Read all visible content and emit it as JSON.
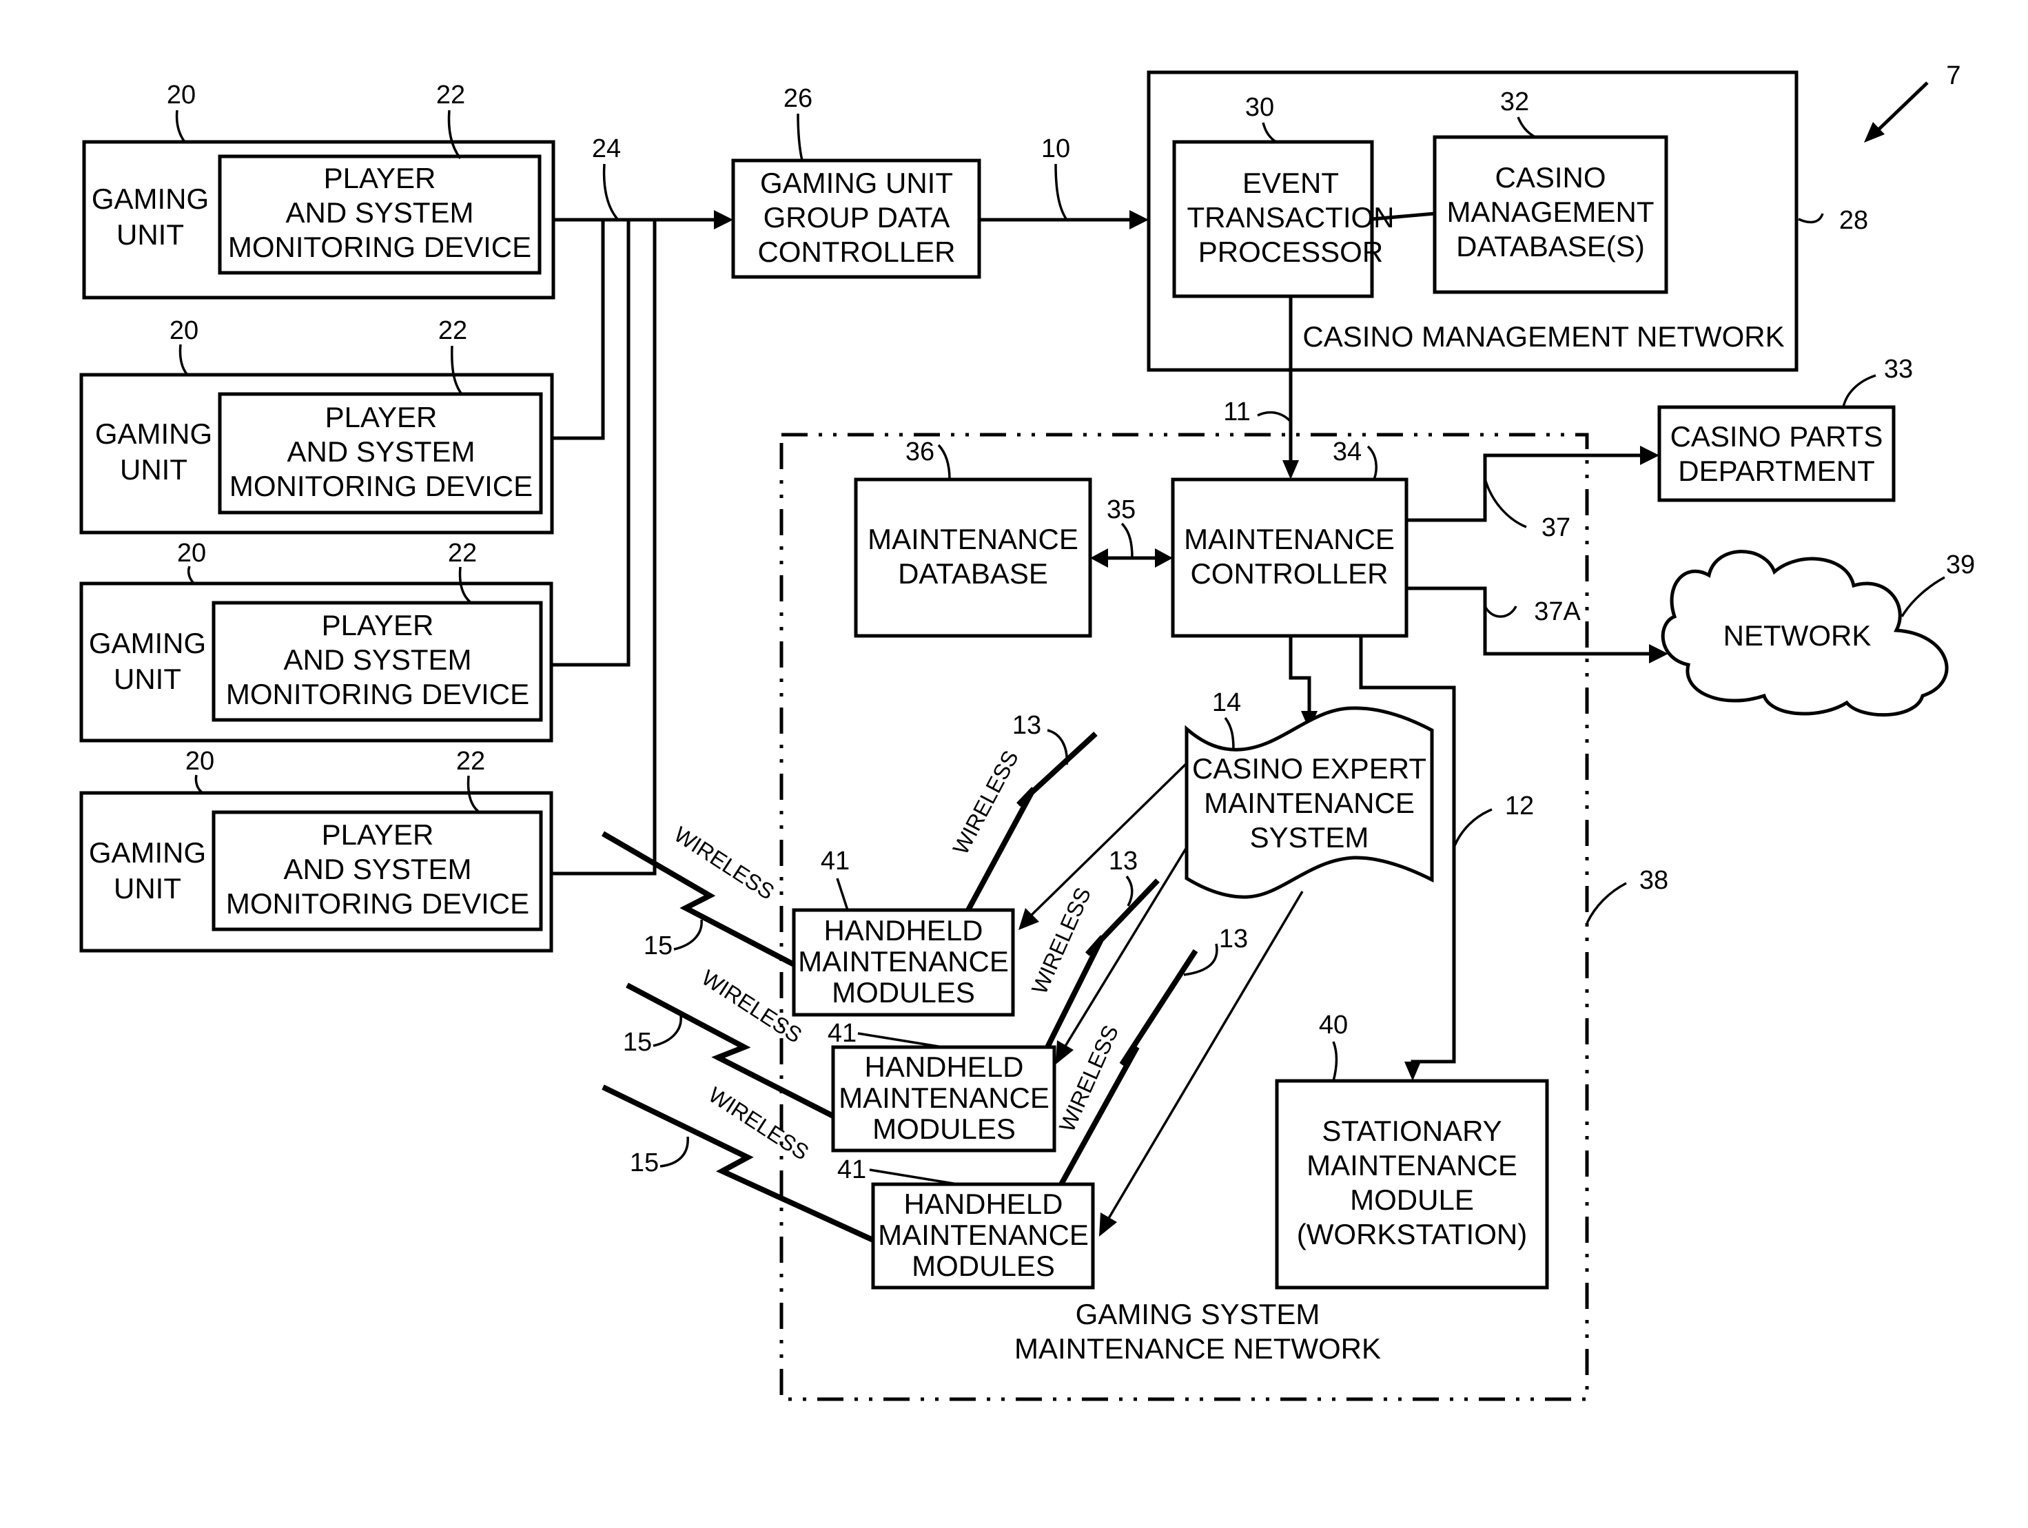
{
  "figure_ref": "7",
  "gaming_units": [
    {
      "ref": "20",
      "label": [
        "GAMING",
        "UNIT"
      ],
      "device_ref": "22",
      "device_label": [
        "PLAYER",
        "AND SYSTEM",
        "MONITORING DEVICE"
      ]
    },
    {
      "ref": "20",
      "label": [
        "GAMING",
        "UNIT"
      ],
      "device_ref": "22",
      "device_label": [
        "PLAYER",
        "AND SYSTEM",
        "MONITORING DEVICE"
      ]
    },
    {
      "ref": "20",
      "label": [
        "GAMING",
        "UNIT"
      ],
      "device_ref": "22",
      "device_label": [
        "PLAYER",
        "AND SYSTEM",
        "MONITORING DEVICE"
      ]
    },
    {
      "ref": "20",
      "label": [
        "GAMING",
        "UNIT"
      ],
      "device_ref": "22",
      "device_label": [
        "PLAYER",
        "AND SYSTEM",
        "MONITORING DEVICE"
      ]
    }
  ],
  "bus_ref": "24",
  "group_controller": {
    "ref": "26",
    "label": [
      "GAMING UNIT",
      "GROUP DATA",
      "CONTROLLER"
    ]
  },
  "link_10": "10",
  "casino_mgmt_network": {
    "ref": "28",
    "label": "CASINO MANAGEMENT NETWORK",
    "event_processor": {
      "ref": "30",
      "label": [
        "EVENT",
        "TRANSACTION",
        "PROCESSOR"
      ]
    },
    "database": {
      "ref": "32",
      "label": [
        "CASINO",
        "MANAGEMENT",
        "DATABASE(S)"
      ]
    }
  },
  "link_11": "11",
  "maintenance_network": {
    "ref": "38",
    "label": [
      "GAMING SYSTEM",
      "MAINTENANCE NETWORK"
    ],
    "maintenance_db": {
      "ref": "36",
      "label": [
        "MAINTENANCE",
        "DATABASE"
      ]
    },
    "link_35": "35",
    "controller": {
      "ref": "34",
      "label": [
        "MAINTENANCE",
        "CONTROLLER"
      ]
    },
    "expert_system": {
      "ref": "14",
      "label": [
        "CASINO EXPERT",
        "MAINTENANCE",
        "SYSTEM"
      ]
    },
    "link_12": "12",
    "stationary": {
      "ref": "40",
      "label": [
        "STATIONARY",
        "MAINTENANCE",
        "MODULE",
        "(WORKSTATION)"
      ]
    },
    "handhelds": [
      {
        "ref": "41",
        "label": [
          "HANDHELD",
          "MAINTENANCE",
          "MODULES"
        ]
      },
      {
        "ref": "41",
        "label": [
          "HANDHELD",
          "MAINTENANCE",
          "MODULES"
        ]
      },
      {
        "ref": "41",
        "label": [
          "HANDHELD",
          "MAINTENANCE",
          "MODULES"
        ]
      }
    ]
  },
  "parts_dept": {
    "ref": "33",
    "label": [
      "CASINO PARTS",
      "DEPARTMENT"
    ]
  },
  "link_37": "37",
  "link_37a": "37A",
  "network": {
    "ref": "39",
    "label": "NETWORK"
  },
  "wireless_label": "WIRELESS",
  "wireless_ref_13": "13",
  "wireless_ref_15": "15"
}
